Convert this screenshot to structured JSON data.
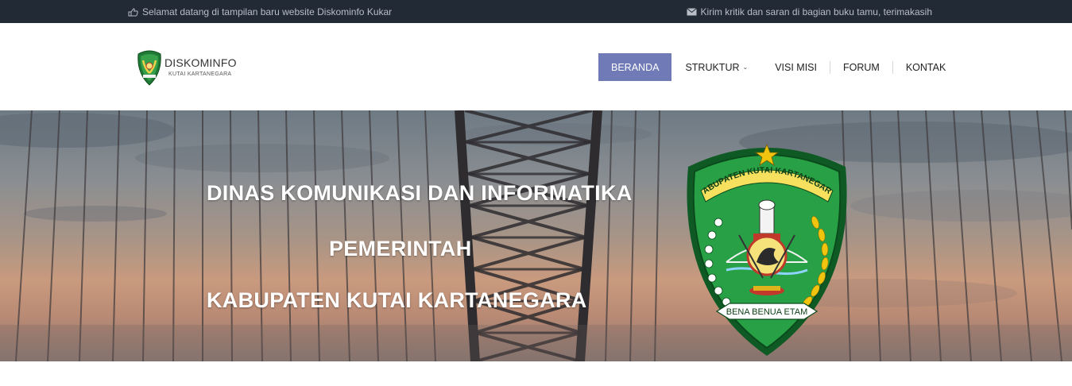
{
  "topbar": {
    "left_text": "Selamat datang di tampilan baru website Diskominfo Kukar",
    "left_icon": "hand-pointer-icon",
    "right_text": "Kirim kritik dan saran di bagian buku tamu, terimakasih",
    "right_icon": "envelope-icon"
  },
  "logo": {
    "title": "DISKOMINFO",
    "subtitle": "KUTAI KARTANEGARA"
  },
  "nav": {
    "items": [
      {
        "label": "BERANDA",
        "active": true
      },
      {
        "label": "STRUKTUR",
        "has_dropdown": true
      },
      {
        "label": "VISI MISI"
      },
      {
        "label": "FORUM"
      },
      {
        "label": "KONTAK"
      }
    ]
  },
  "hero": {
    "line1": "DINAS KOMUNIKASI DAN INFORMATIKA",
    "line2": "PEMERINTAH",
    "line3": "KABUPATEN KUTAI KARTANEGARA",
    "emblem_top_text": "KABUPATEN KUTAI KARTANEGARA",
    "emblem_ribbon_text": "BENA BENUA ETAM"
  },
  "colors": {
    "topbar_bg": "#222a36",
    "nav_active_bg": "#6f7ab7",
    "emblem_green": "#1f8a3a",
    "emblem_gold": "#e0b21c"
  }
}
